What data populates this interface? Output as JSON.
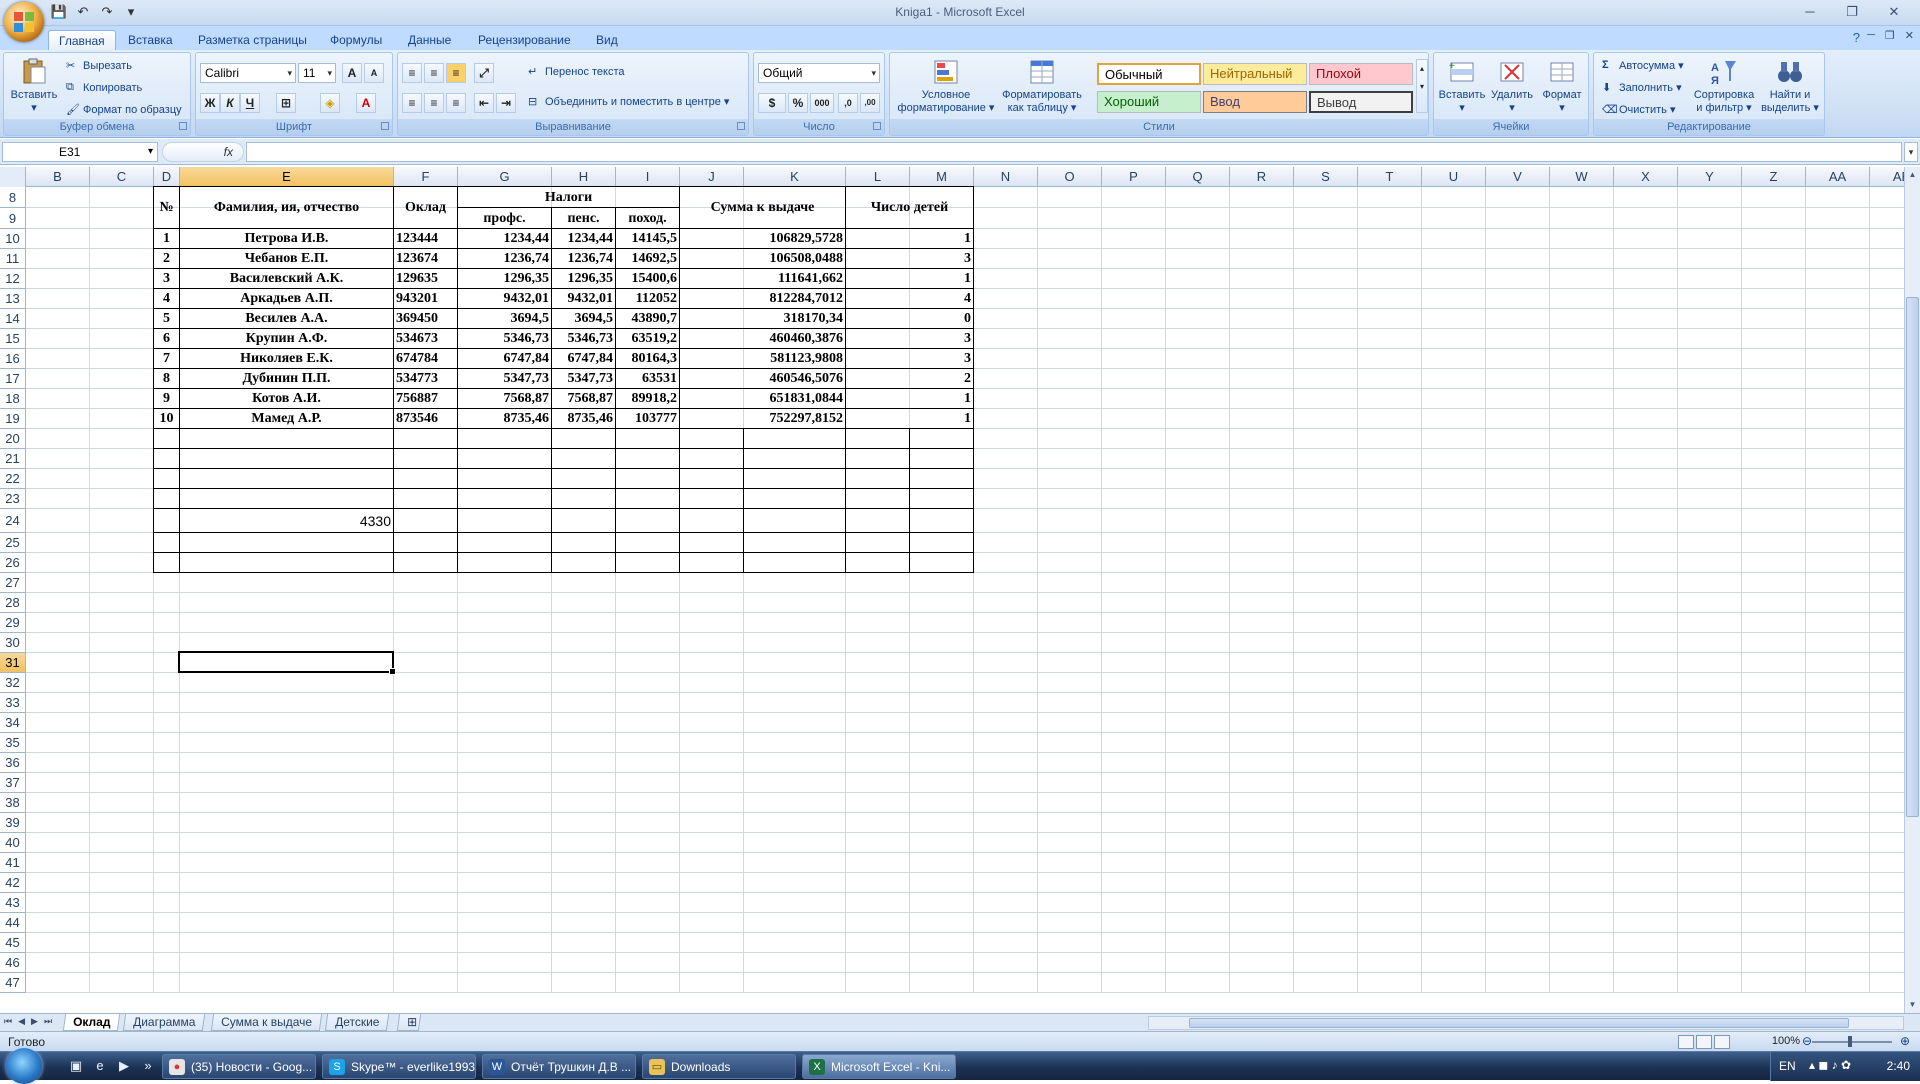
{
  "window": {
    "title": "Kniga1 - Microsoft Excel",
    "minimize": "─",
    "maximize": "❐",
    "close": "✕"
  },
  "qat": {
    "save": "💾",
    "undo": "↶",
    "redo": "↷",
    "more": "▾"
  },
  "tabs": [
    {
      "label": "Главная",
      "active": true
    },
    {
      "label": "Вставка"
    },
    {
      "label": "Разметка страницы"
    },
    {
      "label": "Формулы"
    },
    {
      "label": "Данные"
    },
    {
      "label": "Рецензирование"
    },
    {
      "label": "Вид"
    }
  ],
  "ribbon": {
    "clipboard": {
      "label": "Буфер обмена",
      "paste": "Вставить",
      "cut": "Вырезать",
      "copy": "Копировать",
      "format_painter": "Формат по образцу"
    },
    "font": {
      "label": "Шрифт",
      "name": "Calibri",
      "size": "11",
      "grow": "A",
      "shrink": "A",
      "bold": "Ж",
      "italic": "К",
      "underline": "Ч",
      "border": "⊞",
      "fill": "◈",
      "color": "A"
    },
    "alignment": {
      "label": "Выравнивание",
      "wrap": "Перенос текста",
      "merge": "Объединить и поместить в центре"
    },
    "number": {
      "label": "Число",
      "format": "Общий",
      "currency": "$",
      "percent": "%",
      "thousands": "000",
      "inc": ",0",
      "dec": ",00"
    },
    "styles": {
      "label": "Стили",
      "cond_format": [
        "Условное",
        "форматирование"
      ],
      "format_table": [
        "Форматировать",
        "как таблицу"
      ],
      "cells": [
        {
          "name": "Обычный",
          "bg": "#ffffff",
          "fg": "#000000"
        },
        {
          "name": "Нейтральный",
          "bg": "#ffeb9c",
          "fg": "#9c6500"
        },
        {
          "name": "Плохой",
          "bg": "#ffc7ce",
          "fg": "#9c0006"
        },
        {
          "name": "Хороший",
          "bg": "#c6efce",
          "fg": "#006100"
        },
        {
          "name": "Ввод",
          "bg": "#ffcc99",
          "fg": "#3f3f76"
        },
        {
          "name": "Вывод",
          "bg": "#f2f2f2",
          "fg": "#3f3f3f"
        }
      ]
    },
    "cells": {
      "label": "Ячейки",
      "insert": "Вставить",
      "delete": "Удалить",
      "format": "Формат"
    },
    "editing": {
      "label": "Редактирование",
      "autosum": "Автосумма",
      "fill": "Заполнить",
      "clear": "Очистить",
      "sort": [
        "Сортировка",
        "и фильтр"
      ],
      "find": [
        "Найти и",
        "выделить"
      ]
    }
  },
  "formula_bar": {
    "name_box": "E31",
    "fx": "fx",
    "formula": ""
  },
  "columns": [
    "B",
    "C",
    "D",
    "E",
    "F",
    "G",
    "H",
    "I",
    "J",
    "K",
    "L",
    "M",
    "N",
    "O",
    "P",
    "Q",
    "R",
    "S",
    "T",
    "U",
    "V",
    "W",
    "X",
    "Y",
    "Z",
    "AA",
    "AB"
  ],
  "rows": [
    "8",
    "9",
    "10",
    "11",
    "12",
    "13",
    "14",
    "15",
    "16",
    "17",
    "18",
    "19",
    "20",
    "21",
    "22",
    "23",
    "24",
    "25",
    "26",
    "27",
    "28",
    "29",
    "30",
    "31",
    "32",
    "33",
    "34",
    "35",
    "36",
    "37",
    "38",
    "39",
    "40",
    "41",
    "42",
    "43",
    "44",
    "45",
    "46",
    "47"
  ],
  "selected": {
    "column": "E",
    "row": "31"
  },
  "table": {
    "headers": {
      "num": "№",
      "name": "Фамилия, ия, отчество",
      "salary": "Оклад",
      "taxes": "Налоги",
      "prof": "профс.",
      "pens": "пенс.",
      "inc": "поход.",
      "sum": "Сумма к выдаче",
      "children": "Число детей"
    },
    "rows": [
      [
        "1",
        "Петрова И.В.",
        "123444",
        "1234,44",
        "1234,44",
        "14145,5",
        "106829,5728",
        "1"
      ],
      [
        "2",
        "Чебанов Е.П.",
        "123674",
        "1236,74",
        "1236,74",
        "14692,5",
        "106508,0488",
        "3"
      ],
      [
        "3",
        "Василевский А.К.",
        "129635",
        "1296,35",
        "1296,35",
        "15400,6",
        "111641,662",
        "1"
      ],
      [
        "4",
        "Аркадьев А.П.",
        "943201",
        "9432,01",
        "9432,01",
        "112052",
        "812284,7012",
        "4"
      ],
      [
        "5",
        "Весилев А.А.",
        "369450",
        "3694,5",
        "3694,5",
        "43890,7",
        "318170,34",
        "0"
      ],
      [
        "6",
        "Крупин А.Ф.",
        "534673",
        "5346,73",
        "5346,73",
        "63519,2",
        "460460,3876",
        "3"
      ],
      [
        "7",
        "Николяев Е.К.",
        "674784",
        "6747,84",
        "6747,84",
        "80164,3",
        "581123,9808",
        "3"
      ],
      [
        "8",
        "Дубинин П.П.",
        "534773",
        "5347,73",
        "5347,73",
        "63531",
        "460546,5076",
        "2"
      ],
      [
        "9",
        "Котов А.И.",
        "756887",
        "7568,87",
        "7568,87",
        "89918,2",
        "651831,0844",
        "1"
      ],
      [
        "10",
        "Мамед А.Р.",
        "873546",
        "8735,46",
        "8735,46",
        "103777",
        "752297,8152",
        "1"
      ]
    ],
    "extra_value": "4330"
  },
  "sheets": [
    {
      "label": "Оклад",
      "active": true
    },
    {
      "label": "Диаграмма"
    },
    {
      "label": "Сумма к выдаче"
    },
    {
      "label": "Детские"
    }
  ],
  "status": {
    "ready": "Готово",
    "zoom": "100%",
    "zoom_out": "⊖",
    "zoom_in": "⊕"
  },
  "taskbar": {
    "items": [
      {
        "label": "(35) Новости - Goog...",
        "icon": "chrome-icon"
      },
      {
        "label": "Skype™ - everlike1993",
        "icon": "skype-icon"
      },
      {
        "label": "Отчёт Трушкин Д.В ...",
        "icon": "word-icon"
      },
      {
        "label": "Downloads",
        "icon": "folder-icon"
      },
      {
        "label": "Microsoft Excel - Kni...",
        "icon": "excel-icon",
        "active": true
      }
    ],
    "lang": "EN",
    "clock": "2:40"
  }
}
